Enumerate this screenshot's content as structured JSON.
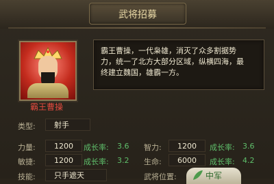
{
  "window": {
    "title": "武将招募"
  },
  "hero": {
    "name": "霸王曹操",
    "description_lines": [
      "霸王曹操，一代枭雄，消灭了众多割据势",
      "力，统一了北方大部分区域，纵横四海，最",
      "终建立魏国，雄霸一方。"
    ]
  },
  "stats": {
    "type": {
      "label": "类型:",
      "value": "射手"
    },
    "strength": {
      "label": "力量:",
      "value": "1200",
      "growth_label": "成长率:",
      "growth": "3.6"
    },
    "intellect": {
      "label": "智力:",
      "value": "1200",
      "growth_label": "成长率:",
      "growth": "3.6"
    },
    "agility": {
      "label": "敏捷:",
      "value": "1200",
      "growth_label": "成长率:",
      "growth": "3.2"
    },
    "life": {
      "label": "生命:",
      "value": "6000",
      "growth_label": "成长率:",
      "growth": "4.2"
    },
    "skill": {
      "label": "技能:",
      "value": "只手遮天"
    },
    "position": {
      "label": "武将位置:",
      "value": "中军"
    }
  },
  "colors": {
    "accent_gold": "#e9d9a6",
    "name_red": "#e34a3e",
    "growth_green": "#5fbf6b"
  },
  "icons": [
    "crown-icon",
    "leaf-icon"
  ]
}
